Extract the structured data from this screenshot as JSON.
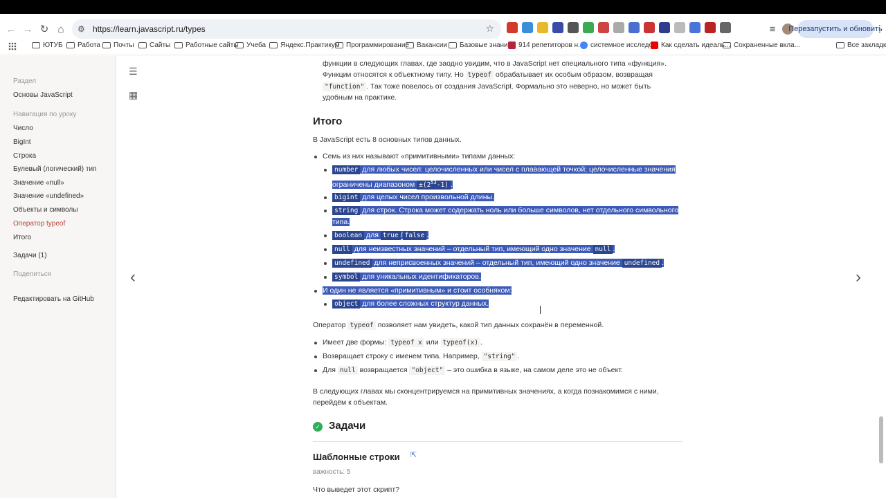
{
  "browser": {
    "url": "https://learn.javascript.ru/types",
    "relaunch_label": "Перезапустить и обновить",
    "bookmarks": [
      "ЮТУБ",
      "Работа",
      "Почты",
      "Сайты",
      "Работные сайты",
      "Учеба",
      "Яндекс.Практикум",
      "Программирование",
      "Вакансии",
      "Базовые знания",
      "914 репетиторов н...",
      "системное исследо...",
      "Как сделать идеаль...",
      "Сохраненные вкла...",
      "Все закладки"
    ]
  },
  "sidebar": {
    "section_label": "Раздел",
    "section_value": "Основы JavaScript",
    "nav_label": "Навигация по уроку",
    "items": [
      "Число",
      "BigInt",
      "Строка",
      "Булевый (логический) тип",
      "Значение «null»",
      "Значение «undefined»",
      "Объекты и символы",
      "Оператор typeof",
      "Итого"
    ],
    "tasks": "Задачи (1)",
    "share": "Поделиться",
    "github": "Редактировать на GitHub"
  },
  "content": {
    "intro_line1": "функции в следующих главах, где заодно увидим, что в JavaScript нет специального типа «функция».",
    "intro_line2_a": "Функции относятся к объектному типу. Но",
    "intro_code1": "typeof",
    "intro_line2_b": "обрабатывает их особым образом, возвращая",
    "intro_code2": "\"function\"",
    "intro_line3_b": ". Так тоже повелось от создания JavaScript. Формально это неверно, но может быть",
    "intro_line4": "удобным на практике.",
    "summary_title": "Итого",
    "summary_lead": "В JavaScript есть 8 основных типов данных.",
    "primitives_lead": "Семь из них называют «примитивными» типами данных:",
    "types": {
      "number_code": "number",
      "number_text_1": " для любых чисел: целочисленных или чисел с плавающей точкой; целочисленные значения",
      "number_text_2": "ограничены диапазоном ",
      "number_range": "±(2",
      "number_exp": "53",
      "number_range_end": "-1)",
      "bigint_code": "bigint",
      "bigint_text": " для целых чисел произвольной длины.",
      "string_code": "string",
      "string_text_1": " для строк. Строка может содержать ноль или больше символов, нет отдельного символьного",
      "string_text_2": "типа.",
      "boolean_code": "boolean",
      "boolean_mid": " для ",
      "true_code": "true",
      "false_code": "false",
      "null_code": "null",
      "null_text": " для неизвестных значений – отдельный тип, имеющий одно значение ",
      "undefined_code": "undefined",
      "undefined_text": " для неприсвоенных значений – отдельный тип, имеющий одно значение ",
      "symbol_code": "symbol",
      "symbol_text": " для уникальных идентификаторов.",
      "nonprim_lead": "И один не является «примитивным» и стоит особняком:",
      "object_code": "object",
      "object_text": " для более сложных структур данных."
    },
    "typeof_lead_a": "Оператор",
    "typeof_code": "typeof",
    "typeof_lead_b": "позволяет нам увидеть, какой тип данных сохранён в переменной.",
    "forms_a": "Имеет две формы:",
    "forms_code1": "typeof x",
    "forms_or": "или",
    "forms_code2": "typeof(x)",
    "returns_a": "Возвращает строку с именем типа. Например,",
    "returns_code": "\"string\"",
    "null_a": "Для",
    "null_code": "null",
    "null_b": "возвращается",
    "null_code2": "\"object\"",
    "null_c": "– это ошибка в языке, на самом деле это не объект.",
    "next_1": "В следующих главах мы сконцентрируемся на примитивных значениях, а когда познакомимся с ними,",
    "next_2": "перейдём к объектам.",
    "tasks_title": "Задачи",
    "task_title": "Шаблонные строки",
    "importance": "важность: 5",
    "question": "Что выведет этот скрипт?"
  }
}
